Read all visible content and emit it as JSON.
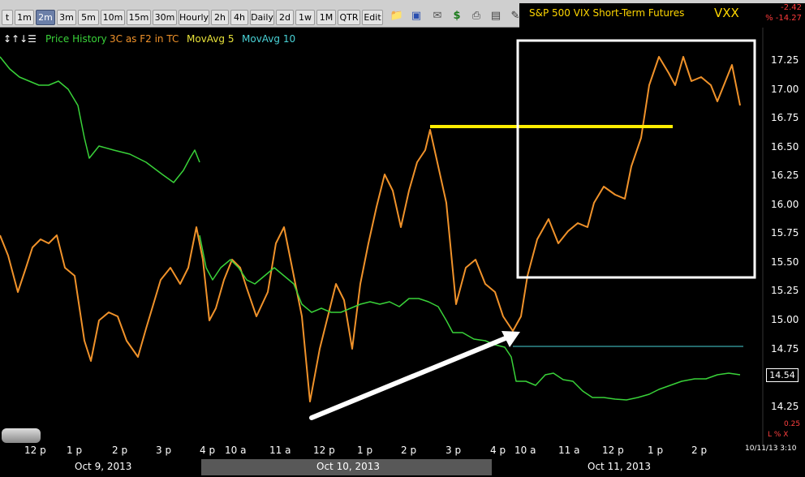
{
  "toolbar": {
    "timeframes": [
      "t",
      "1m",
      "2m",
      "3m",
      "5m",
      "10m",
      "15m",
      "30m",
      "Hourly",
      "2h",
      "4h",
      "Daily",
      "2d",
      "1w",
      "1M",
      "QTR",
      "Edit"
    ],
    "active_timeframe": "2m",
    "icons": [
      "folder-icon",
      "save-icon",
      "email-icon",
      "dollar-icon",
      "print-icon",
      "image-icon",
      "draw-pencil-icon"
    ]
  },
  "symbol": {
    "title": "S&P 500 VIX Short-Term Futures",
    "ticker": "VXX",
    "change": "-2.42",
    "change_pct": "% -14.27"
  },
  "legend": {
    "items": [
      {
        "label": "Price History",
        "color": "#39d239"
      },
      {
        "label": "3C as F2 in TC",
        "color": "#f0922a"
      },
      {
        "label": "MovAvg 5",
        "color": "#e8e23a"
      },
      {
        "label": "MovAvg 10",
        "color": "#49d2d6"
      }
    ]
  },
  "price_axis": {
    "labels": [
      "17.25",
      "17.00",
      "16.75",
      "16.50",
      "16.25",
      "16.00",
      "15.75",
      "15.50",
      "15.25",
      "15.00",
      "14.75",
      "14.25"
    ],
    "last_price": "14.54"
  },
  "indicator_panel": {
    "value": "0.25",
    "flags": "L % X"
  },
  "time_axis": {
    "labels": [
      "12 p",
      "1 p",
      "2 p",
      "3 p",
      "4 p",
      "10 a",
      "11 a",
      "12 p",
      "1 p",
      "2 p",
      "3 p",
      "4 p",
      "10 a",
      "11 a",
      "12 p",
      "1 p",
      "2 p"
    ],
    "dates": [
      "Oct 9, 2013",
      "Oct 10, 2013",
      "Oct 11, 2013"
    ],
    "timestamp": "10/11/13 3:10"
  },
  "colors": {
    "price": "#39d239",
    "indicator": "#f0922a",
    "resistance": "#ffee00",
    "box": "#ffffff",
    "arrow": "#ffffff",
    "level_line": "#49d2d6"
  }
}
